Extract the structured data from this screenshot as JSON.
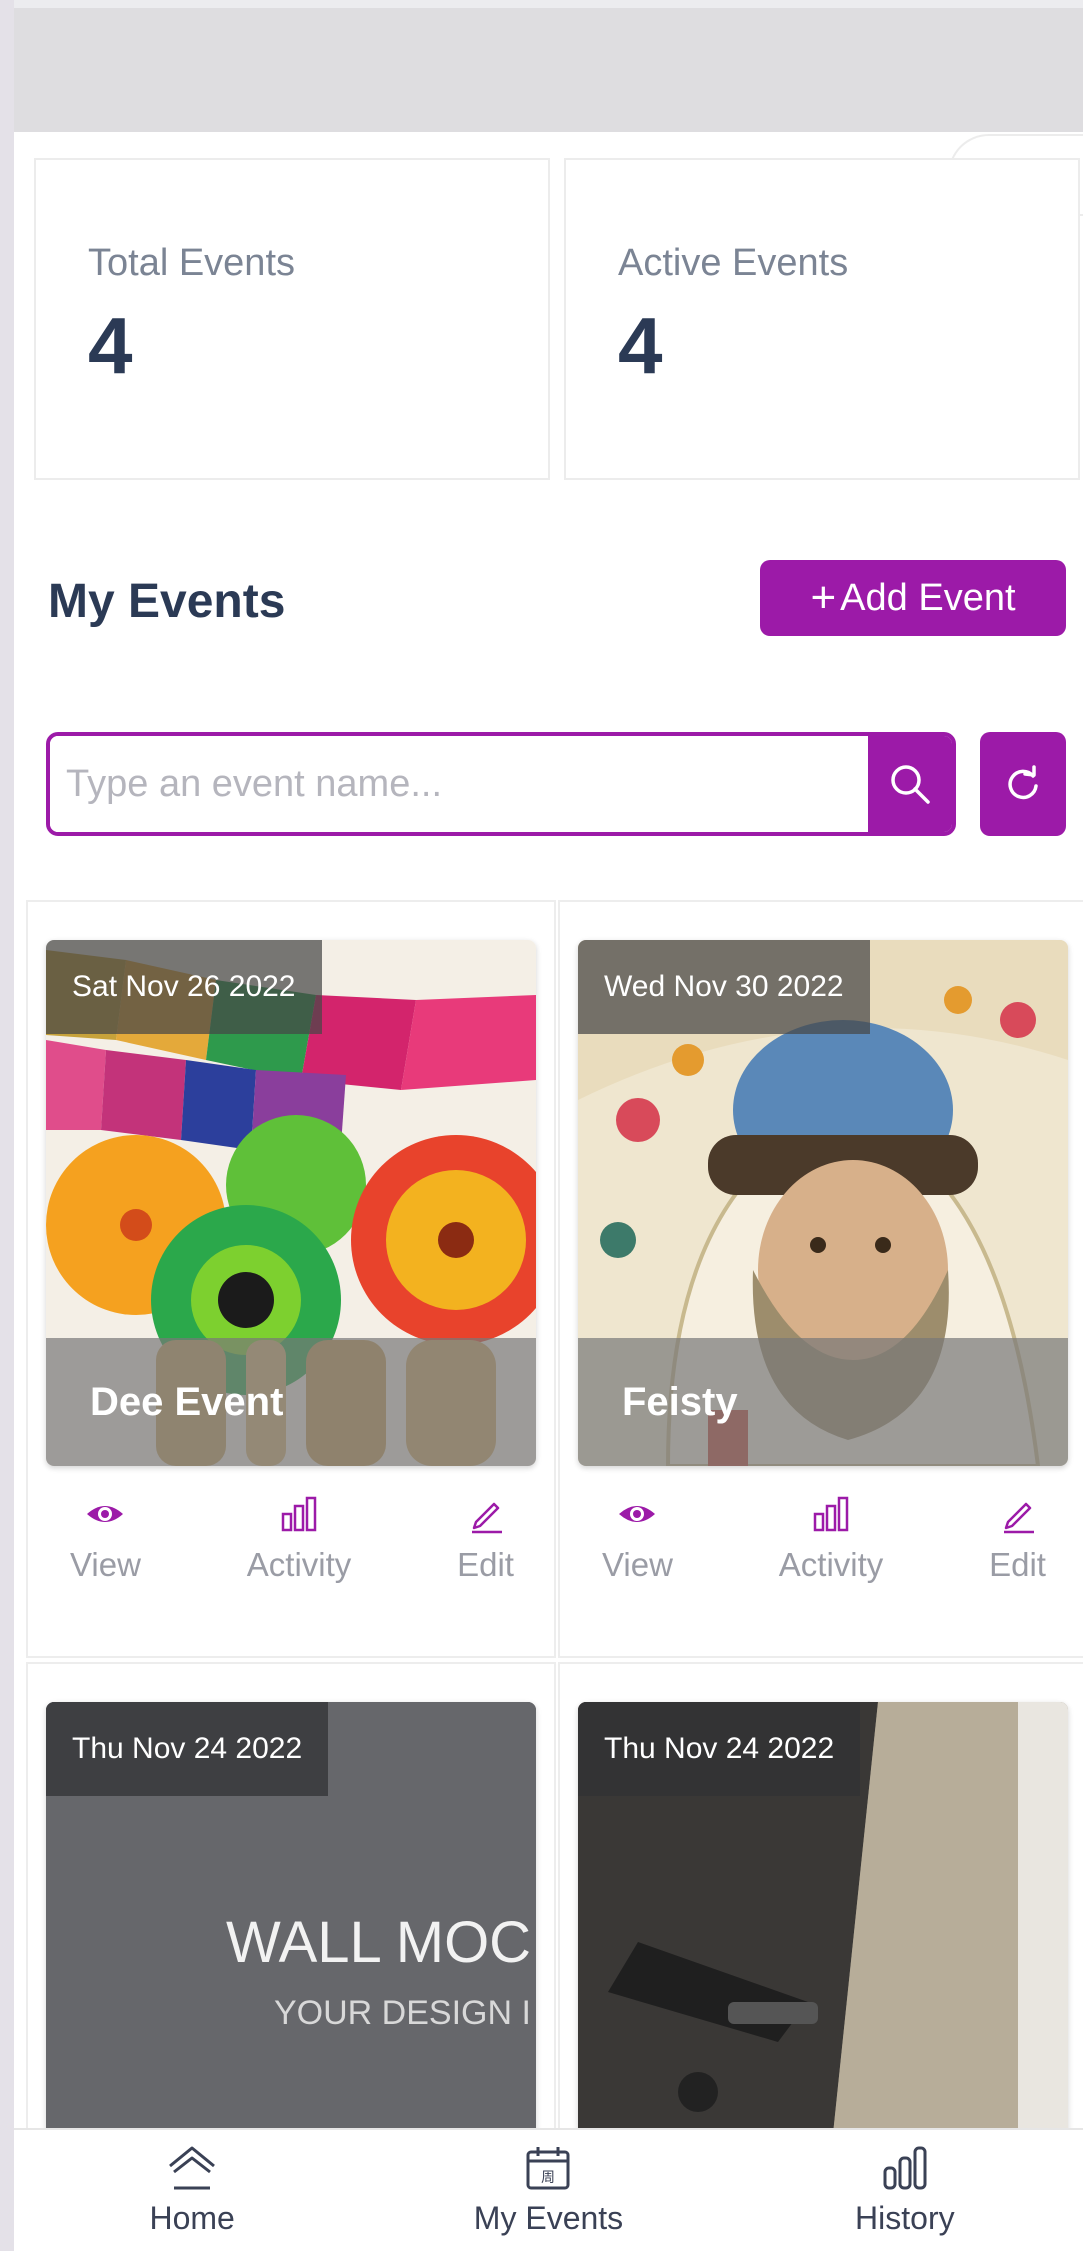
{
  "header": {
    "more_label": "•••"
  },
  "stats": [
    {
      "label": "Total Events",
      "value": "4"
    },
    {
      "label": "Active Events",
      "value": "4"
    }
  ],
  "events_section": {
    "title": "My Events",
    "add_button": "Add Event",
    "add_button_icon": "+"
  },
  "search": {
    "placeholder": "Type an event name..."
  },
  "events": [
    {
      "date": "Sat Nov 26 2022",
      "name": "Dee Event",
      "view": "View",
      "activity": "Activity",
      "edit": "Edit"
    },
    {
      "date": "Wed Nov 30 2022",
      "name": "Feisty",
      "view": "View",
      "activity": "Activity",
      "edit": "Edit"
    },
    {
      "date": "Thu Nov 24 2022",
      "image_text_line1": "WALL MOC",
      "image_text_line2": "YOUR DESIGN I"
    },
    {
      "date": "Thu Nov 24 2022"
    }
  ],
  "bottom_nav": [
    {
      "label": "Home",
      "icon": "home-icon"
    },
    {
      "label": "My Events",
      "icon": "calendar-icon",
      "icon_glyph": "周"
    },
    {
      "label": "History",
      "icon": "bar-chart-icon"
    }
  ],
  "colors": {
    "accent": "#9c1aa8",
    "text_dark": "#2b3a55",
    "text_muted": "#9a9ca5"
  }
}
